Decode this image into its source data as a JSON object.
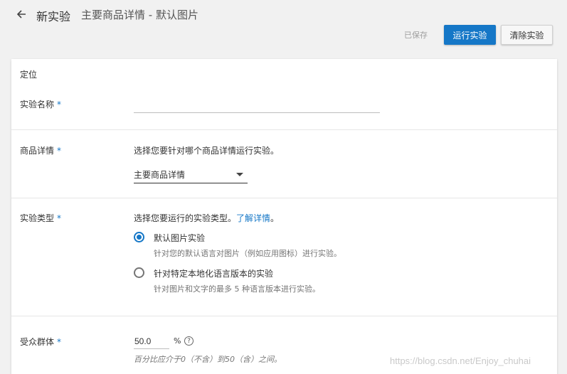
{
  "header": {
    "title": "新实验",
    "subtitle": "主要商品详情 - 默认图片"
  },
  "actions": {
    "saved_status": "已保存",
    "run_label": "运行实验",
    "clear_label": "清除实验"
  },
  "form": {
    "section_title": "定位",
    "experiment_name": {
      "label": "实验名称",
      "required": "*",
      "value": ""
    },
    "listing": {
      "label": "商品详情",
      "required": "*",
      "description": "选择您要针对哪个商品详情运行实验。",
      "selected": "主要商品详情"
    },
    "experiment_type": {
      "label": "实验类型",
      "required": "*",
      "description": "选择您要运行的实验类型。",
      "learn_more": "了解详情",
      "options": [
        {
          "label": "默认图片实验",
          "hint": "针对您的默认语言对图片（例如应用图标）进行实验。",
          "selected": true
        },
        {
          "label": "针对特定本地化语言版本的实验",
          "hint": "针对图片和文字的最多 5 种语言版本进行实验。",
          "selected": false
        }
      ]
    },
    "audience": {
      "label": "受众群体",
      "required": "*",
      "value": "50.0",
      "unit": "%",
      "help": "?",
      "range_hint": "百分比应介于0（不含）到50（含）之间。"
    }
  },
  "watermark": "https://blog.csdn.net/Enjoy_chuhai",
  "colors": {
    "accent": "#1577c7",
    "background": "#f1f1f1"
  }
}
